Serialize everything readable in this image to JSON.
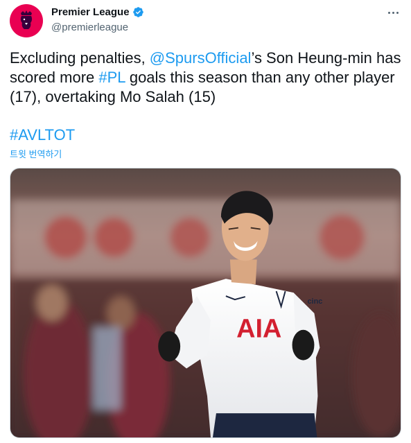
{
  "account": {
    "display_name": "Premier League",
    "handle": "@premierleague",
    "verified": true,
    "avatar_icon": "premier-league-lion-logo",
    "brand_color": "#e90052"
  },
  "tweet": {
    "text_part1": "Excluding penalties, ",
    "mention": "@SpursOfficial",
    "text_part2": "’s Son Heung-min has scored more ",
    "hashtag_pl": "#PL",
    "text_part3": " goals this season than any other player (17), overtaking Mo Salah (15)",
    "hashtag_match": "#AVLTOT",
    "translate_label": "트윗 번역하기"
  },
  "media": {
    "shirt_sponsor": "AIA",
    "shirt_text_partial": "cinc"
  },
  "colors": {
    "link": "#1d9bf0",
    "text": "#0f1419",
    "secondary": "#536471"
  }
}
